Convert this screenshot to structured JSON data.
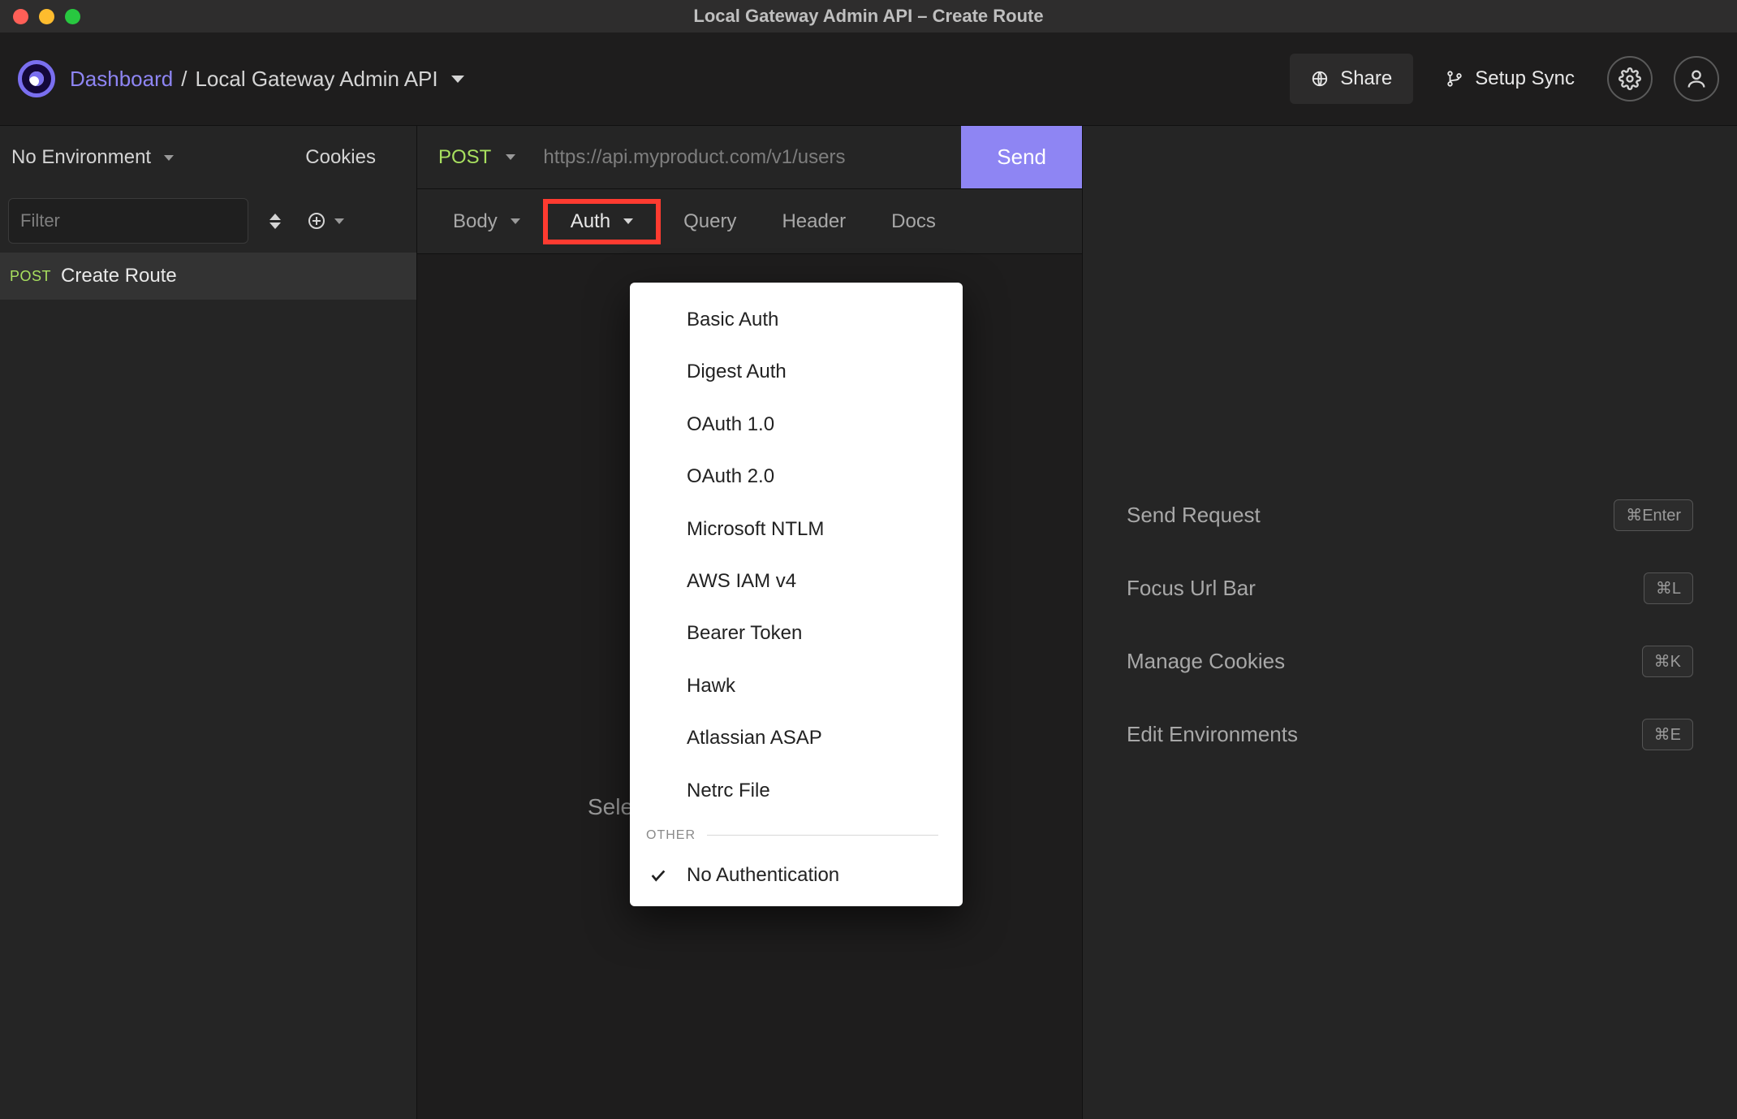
{
  "window": {
    "title": "Local Gateway Admin API – Create Route"
  },
  "breadcrumb": {
    "dashboard": "Dashboard",
    "separator": "/",
    "project": "Local Gateway Admin API"
  },
  "topnav": {
    "share": "Share",
    "setup_sync": "Setup Sync"
  },
  "sidebar": {
    "environment": "No Environment",
    "cookies": "Cookies",
    "filter_placeholder": "Filter",
    "items": [
      {
        "method": "POST",
        "name": "Create Route"
      }
    ]
  },
  "request": {
    "method": "POST",
    "url_placeholder": "https://api.myproduct.com/v1/users",
    "send": "Send"
  },
  "tabs": {
    "body": "Body",
    "auth": "Auth",
    "query": "Query",
    "header": "Header",
    "docs": "Docs"
  },
  "center_placeholder_prefix": "Sele",
  "auth_dropdown": {
    "items": [
      "Basic Auth",
      "Digest Auth",
      "OAuth 1.0",
      "OAuth 2.0",
      "Microsoft NTLM",
      "AWS IAM v4",
      "Bearer Token",
      "Hawk",
      "Atlassian ASAP",
      "Netrc File"
    ],
    "other_label": "OTHER",
    "no_auth": "No Authentication"
  },
  "right_hints": [
    {
      "label": "Send Request",
      "kbd": "⌘Enter"
    },
    {
      "label": "Focus Url Bar",
      "kbd": "⌘L"
    },
    {
      "label": "Manage Cookies",
      "kbd": "⌘K"
    },
    {
      "label": "Edit Environments",
      "kbd": "⌘E"
    }
  ]
}
